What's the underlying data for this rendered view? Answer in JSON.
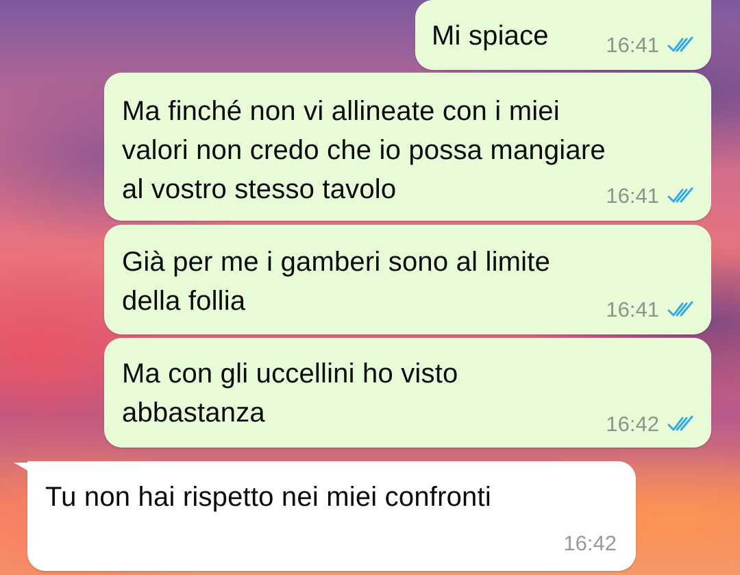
{
  "messages": [
    {
      "direction": "outgoing",
      "text": "Mi spiace",
      "time": "16:41",
      "status_icon": "double-check-read-icon"
    },
    {
      "direction": "outgoing",
      "text": "Ma finché non vi allineate con i miei\nvalori non credo che io possa mangiare\nal vostro stesso tavolo",
      "time": "16:41",
      "status_icon": "double-check-read-icon"
    },
    {
      "direction": "outgoing",
      "text": "Già per me i gamberi sono al limite\ndella follia",
      "time": "16:41",
      "status_icon": "double-check-read-icon"
    },
    {
      "direction": "outgoing",
      "text": "Ma con gli uccellini ho visto\nabbastanza",
      "time": "16:42",
      "status_icon": "double-check-read-icon"
    },
    {
      "direction": "incoming",
      "text": "Tu non hai rispetto nei miei confronti",
      "time": "16:42"
    }
  ],
  "colors": {
    "outgoing_bubble": "#e7fcd6",
    "incoming_bubble": "#ffffff",
    "read_ticks": "#34a8e8",
    "timestamp": "#8a948b"
  }
}
